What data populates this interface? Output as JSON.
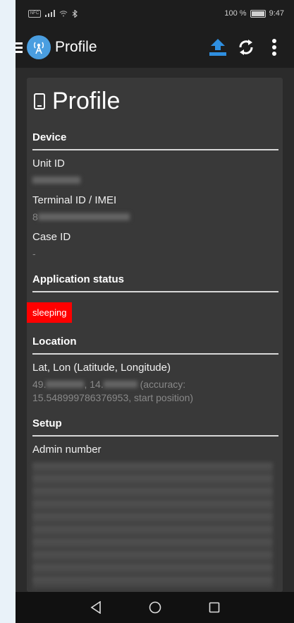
{
  "status_bar": {
    "left_icons": [
      "nfc-icon",
      "signal-icon",
      "wifi-icon",
      "bluetooth-icon"
    ],
    "battery": "100 %",
    "time": "9:47"
  },
  "app_bar": {
    "title": "Profile",
    "icons": [
      "upload-icon",
      "sync-icon",
      "more-vert-icon"
    ]
  },
  "card": {
    "title": "Profile",
    "device": {
      "heading": "Device",
      "unit_id_label": "Unit ID",
      "terminal_label": "Terminal ID / IMEI",
      "terminal_value": "8",
      "case_id_label": "Case ID",
      "case_id_value": "-"
    },
    "app_status": {
      "heading": "Application status",
      "badge": "sleeping"
    },
    "location": {
      "heading": "Location",
      "label": "Lat, Lon (Latitude, Longitude)",
      "lat_prefix": "49.",
      "lon_prefix": ", 14.",
      "accuracy": " (accuracy: 15.548999786376953, start position)"
    },
    "setup": {
      "heading": "Setup",
      "admin_label": "Admin number"
    }
  },
  "colors": {
    "badge": "#ff0000",
    "accent": "#4a9ee0",
    "card_bg": "#393939"
  }
}
